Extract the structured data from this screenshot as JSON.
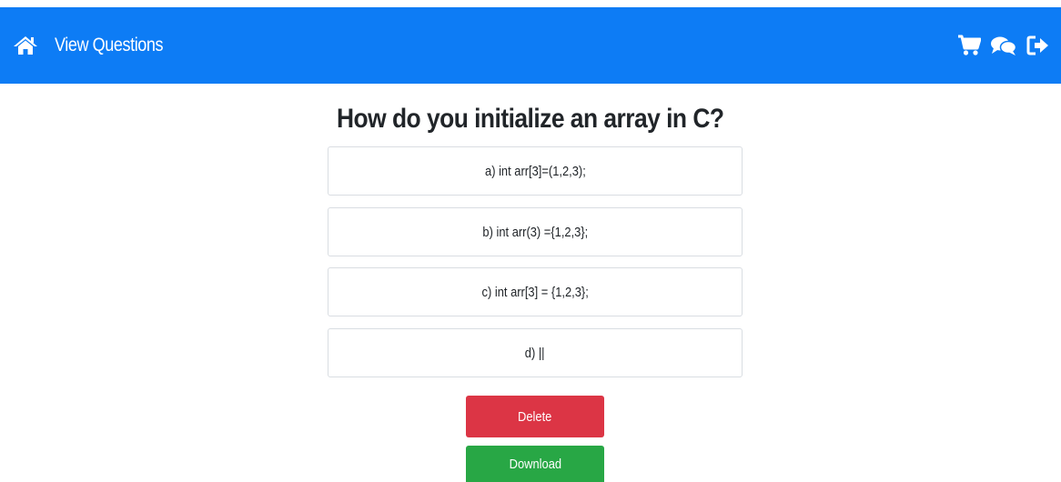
{
  "navbar": {
    "home_icon": "home-icon",
    "title": "View Questions",
    "icons": [
      "cart-icon",
      "comments-icon",
      "sign-out-icon"
    ],
    "background": "#0d7cf5"
  },
  "question": {
    "text": "How do you initialize an array in C?",
    "options": [
      "a) int arr[3]=(1,2,3);",
      "b) int arr(3) ={1,2,3};",
      "c) int arr[3] = {1,2,3};",
      "d) ||"
    ]
  },
  "actions": {
    "delete_label": "Delete",
    "download_label": "Download",
    "delete_color": "#dc3545",
    "download_color": "#28a745"
  }
}
